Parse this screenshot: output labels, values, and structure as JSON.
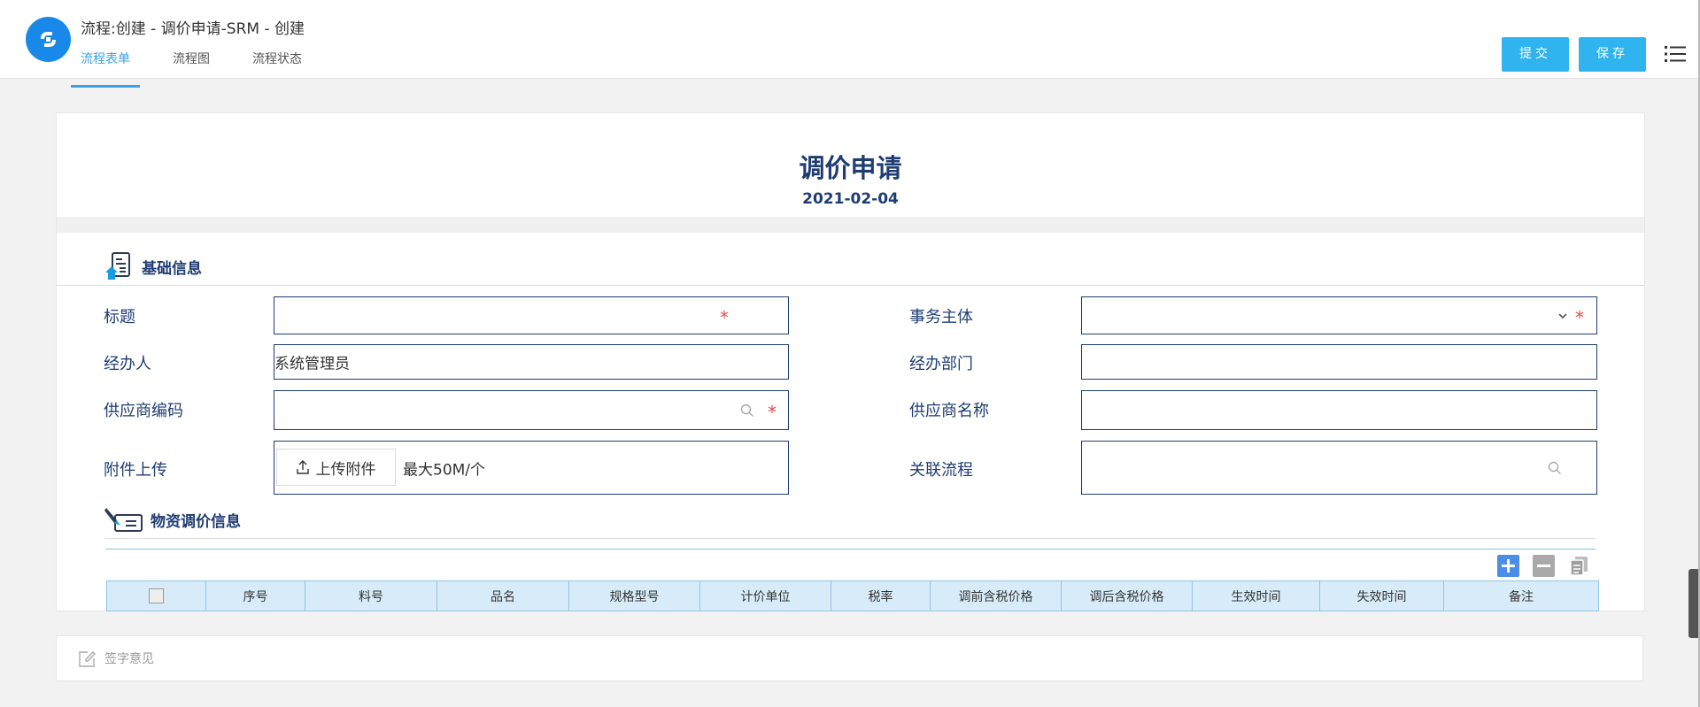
{
  "header": {
    "title": "流程:创建 - 调价申请-SRM - 创建",
    "tabs": [
      {
        "label": "流程表单"
      },
      {
        "label": "流程图"
      },
      {
        "label": "流程状态"
      }
    ],
    "submit_label": "提交",
    "save_label": "保存"
  },
  "form": {
    "title": "调价申请",
    "date": "2021-02-04",
    "sections": {
      "basic": "基础信息",
      "material": "物资调价信息"
    },
    "fields": {
      "title": {
        "label": "标题",
        "value": ""
      },
      "entity": {
        "label": "事务主体",
        "value": ""
      },
      "handler": {
        "label": "经办人",
        "value": "系统管理员"
      },
      "department": {
        "label": "经办部门",
        "value": ""
      },
      "supplier_code": {
        "label": "供应商编码",
        "value": ""
      },
      "supplier_name": {
        "label": "供应商名称",
        "value": ""
      },
      "attachment": {
        "label": "附件上传",
        "button": "上传附件",
        "hint": "最大50M/个"
      },
      "related": {
        "label": "关联流程",
        "value": ""
      }
    },
    "required_mark": "*",
    "table": {
      "columns": [
        "序号",
        "料号",
        "品名",
        "规格型号",
        "计价单位",
        "税率",
        "调前含税价格",
        "调后含税价格",
        "生效时间",
        "失效时间",
        "备注"
      ],
      "rows": []
    }
  },
  "sign": {
    "placeholder": "签字意见"
  },
  "colors": {
    "accent": "#2fb4f0",
    "tab_active": "#3aa0e4",
    "brand": "#1989e9",
    "form_text": "#1f3d73",
    "required": "#e84a4a"
  }
}
